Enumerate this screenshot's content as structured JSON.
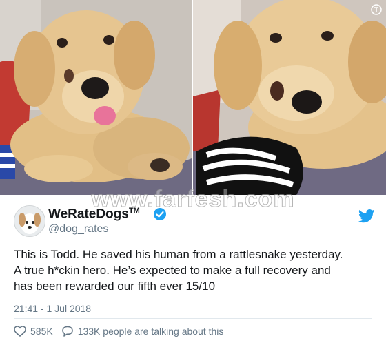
{
  "watermark": "www.farfesh.com",
  "profile": {
    "name": "WeRateDogs",
    "trademark": "TM",
    "handle": "@dog_rates",
    "avatar_icon": "dog-avatar-icon"
  },
  "tweet": {
    "lines": [
      "This is Todd. He saved his human from a rattlesnake yesterday.",
      "A true h*ckin hero. He’s expected to make a full recovery and",
      "has been rewarded our fifth ever 15/10"
    ],
    "timestamp": "21:41 - 1 Jul 2018"
  },
  "actions": {
    "likes": "585K",
    "talking": "133K people are talking about this"
  },
  "colors": {
    "twitter_blue": "#1da1f2",
    "text": "#14171a",
    "muted": "#657786"
  }
}
